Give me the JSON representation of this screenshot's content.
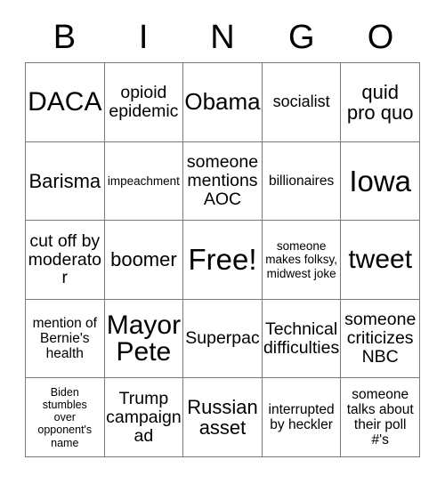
{
  "header": {
    "letters": [
      "B",
      "I",
      "N",
      "G",
      "O"
    ]
  },
  "grid": {
    "rows": 5,
    "columns": 5,
    "free_space_label": "Free!",
    "cells": [
      {
        "text": "DACA",
        "size": "xxl"
      },
      {
        "text": "opioid\nepidemic",
        "size": "ml"
      },
      {
        "text": "Obama",
        "size": "xl"
      },
      {
        "text": "socialist",
        "size": "m"
      },
      {
        "text": "quid\npro quo",
        "size": "l"
      },
      {
        "text": "Barisma",
        "size": "l"
      },
      {
        "text": "impeachment",
        "size": "xs"
      },
      {
        "text": "someone\nmentions\nAOC",
        "size": "ml"
      },
      {
        "text": "billionaires",
        "size": "s"
      },
      {
        "text": "Iowa",
        "size": "huge"
      },
      {
        "text": "cut off by\nmoderator",
        "size": "ml"
      },
      {
        "text": "boomer",
        "size": "l"
      },
      {
        "text": "Free!",
        "size": "huge"
      },
      {
        "text": "someone\nmakes folksy,\nmidwest joke",
        "size": "xs"
      },
      {
        "text": "tweet",
        "size": "xxl"
      },
      {
        "text": "mention of\nBernie's\nhealth",
        "size": "s"
      },
      {
        "text": "Mayor\nPete",
        "size": "xxl"
      },
      {
        "text": "Superpac",
        "size": "ml"
      },
      {
        "text": "Technical\ndifficulties",
        "size": "ml"
      },
      {
        "text": "someone\ncriticizes\nNBC",
        "size": "ml"
      },
      {
        "text": "Biden\nstumbles\nover\nopponent's\nname",
        "size": "xxs"
      },
      {
        "text": "Trump\ncampaign\nad",
        "size": "ml"
      },
      {
        "text": "Russian\nasset",
        "size": "l"
      },
      {
        "text": "interrupted\nby heckler",
        "size": "s"
      },
      {
        "text": "someone\ntalks about\ntheir poll\n#'s",
        "size": "s"
      }
    ]
  },
  "colors": {
    "background": "#ffffff",
    "text": "#000000",
    "grid_line": "#7a7a7a"
  }
}
